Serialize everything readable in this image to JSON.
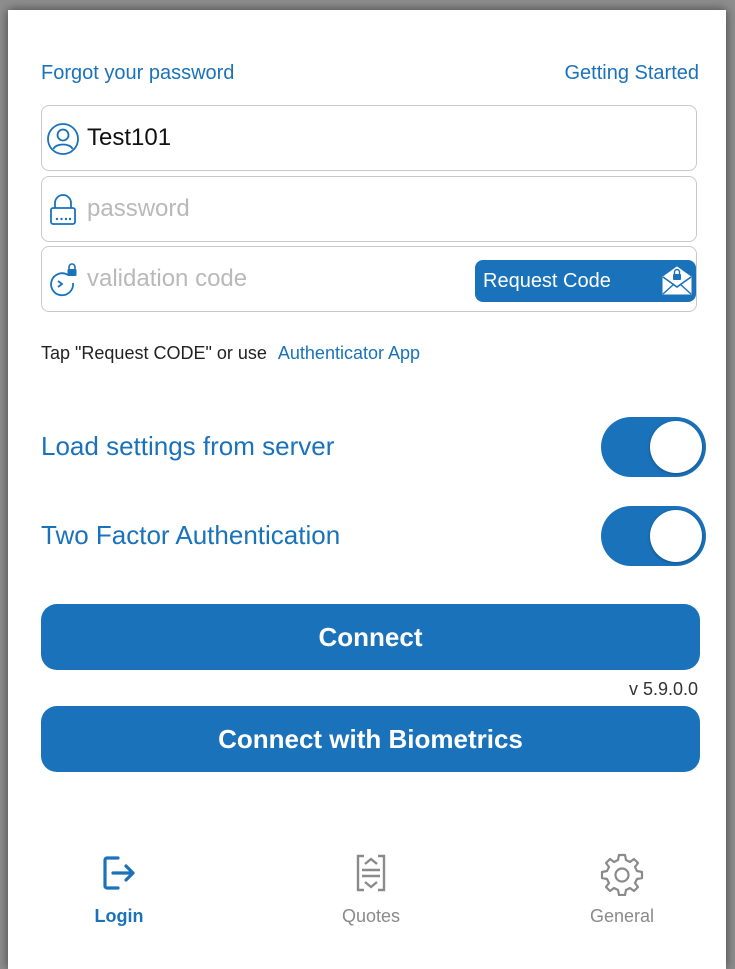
{
  "links": {
    "forgot_password": "Forgot your password",
    "getting_started": "Getting Started"
  },
  "form": {
    "username_value": "Test101",
    "password_placeholder": "password",
    "validation_placeholder": "validation code",
    "request_code_label": "Request Code"
  },
  "hint": {
    "text": "Tap \"Request CODE\" or use",
    "link": "Authenticator App"
  },
  "toggles": [
    {
      "label": "Load settings from server",
      "on": true
    },
    {
      "label": "Two Factor Authentication",
      "on": true
    }
  ],
  "buttons": {
    "connect": "Connect",
    "connect_biometrics": "Connect with Biometrics"
  },
  "version": "v 5.9.0.0",
  "tabs": [
    {
      "label": "Login",
      "icon": "login-icon",
      "active": true
    },
    {
      "label": "Quotes",
      "icon": "quotes-icon",
      "active": false
    },
    {
      "label": "General",
      "icon": "gear-icon",
      "active": false
    }
  ],
  "colors": {
    "accent": "#1a72bb",
    "placeholder": "#b9b9b9",
    "inactive_tab": "#8a8a8a"
  }
}
